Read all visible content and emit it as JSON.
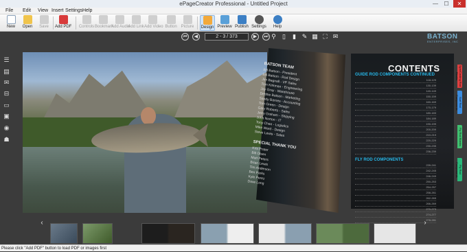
{
  "window": {
    "title": "ePageCreator Professional - Untitled Project",
    "controls": {
      "minimize": "—",
      "maximize": "☐",
      "close": "✕"
    }
  },
  "menu": [
    "File",
    "Edit",
    "View",
    "Insert",
    "Settings",
    "Help"
  ],
  "toolbar": {
    "new": "New",
    "open": "Open",
    "save": "Save",
    "add_pdf": "Add PDF",
    "controls": "Controls",
    "bookmark": "Bookmark",
    "add_audio": "Add Audio",
    "add_link": "Add Link",
    "add_video": "Add Video",
    "button": "Button",
    "picture": "Picture",
    "design": "Design",
    "preview": "Preview",
    "publish": "Publish",
    "settings": "Settings",
    "help": "Help"
  },
  "nav": {
    "page_indicator": "2 - 3 / 373"
  },
  "brand": {
    "watermark": "BATSON",
    "watermark_sub": "ENTERPRISES, INC"
  },
  "left_page": {
    "team_title": "BATSON TEAM",
    "team": [
      "Bill Batson - President",
      "Bill Batson - Rod Design",
      "Jim Bagnall - VP Sales",
      "Tom Kirkman - Engineering",
      "Jay Gray - Warehouse",
      "Debbie Batson - Marketing",
      "Sandy Barnes - Accounting",
      "Tom Green - Design",
      "Gary Roberts - Sales",
      "Jerry Graham - Shipping",
      "John Norton - IT",
      "Tony Chan - Logistics",
      "Mike Ward - Design",
      "Steve Lewis - Sales"
    ],
    "thanks_title": "SPECIAL THANK YOU",
    "thanks": [
      "Kris Prater",
      "Bill Olsen",
      "Matt Peters",
      "Brian Lewis",
      "Tim Anderson",
      "Ben Parks",
      "Kyle Perez",
      "Dave Long"
    ]
  },
  "right_page": {
    "title": "CONTENTS",
    "section1": "GUIDE ROD COMPONENTS CONTINUED",
    "rows": [
      {
        "num": "118-129"
      },
      {
        "num": "130-139"
      },
      {
        "num": "140-149"
      },
      {
        "num": "150-159"
      },
      {
        "num": "160-169"
      },
      {
        "num": "170-179"
      },
      {
        "num": "180-183"
      },
      {
        "num": "184-189"
      },
      {
        "num": "190-199"
      },
      {
        "num": "200-209"
      },
      {
        "num": "210-219"
      },
      {
        "num": "220-229"
      },
      {
        "num": "230-235"
      },
      {
        "num": "236-239"
      }
    ],
    "section2": "FLY ROD COMPONENTS",
    "rows2": [
      {
        "num": "239-241"
      },
      {
        "num": "242-245"
      },
      {
        "num": "246-249"
      },
      {
        "num": "250-253"
      },
      {
        "num": "254-257"
      },
      {
        "num": "258-261"
      },
      {
        "num": "262-265"
      },
      {
        "num": "266-269"
      },
      {
        "num": "270-273"
      },
      {
        "num": "274-277"
      },
      {
        "num": "278-281"
      }
    ]
  },
  "page_tabs": [
    "Spin/Casting Rod Blanks",
    "Surf Rod Components",
    "Fly Rod Blanks",
    "Fly Rod Components"
  ],
  "colors": {
    "accent_blue": "#27b7e8",
    "tab1": "#e04040",
    "tab2": "#3c8de0",
    "tab3": "#40c070",
    "tab4": "#2ab87a"
  },
  "status": "Please click \"Add PDF\" button to load PDF or images first"
}
